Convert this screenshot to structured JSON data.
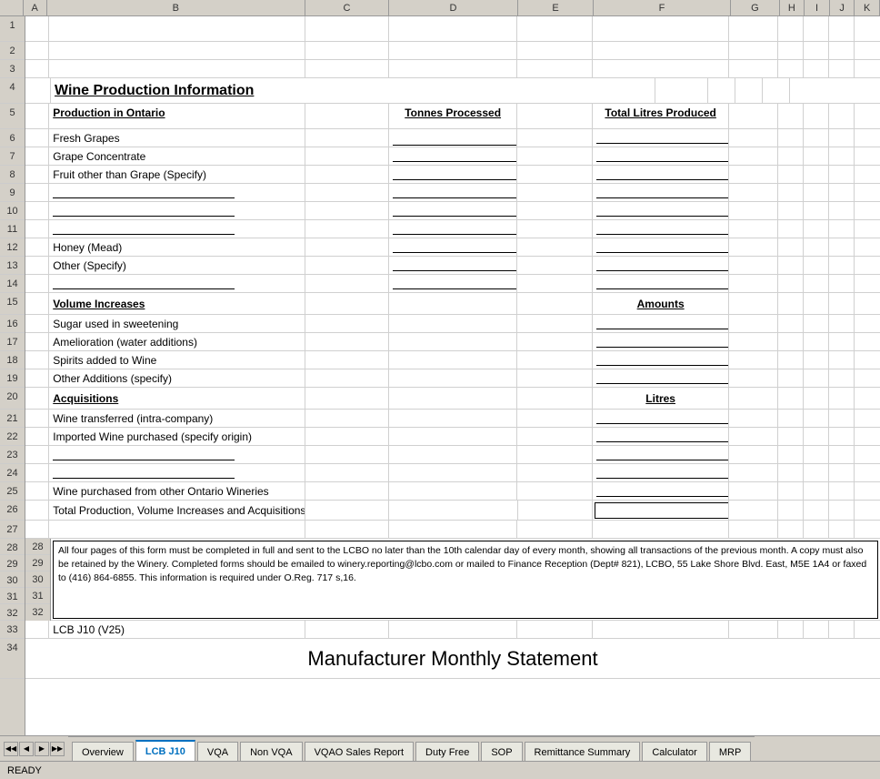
{
  "title": "Wine Production Information",
  "columns": [
    "",
    "A",
    "B",
    "C",
    "D",
    "E",
    "F",
    "G",
    "H",
    "I",
    "J",
    "K"
  ],
  "rows": {
    "row4": {
      "label": "4",
      "content": "Wine Production Information"
    },
    "row5": {
      "label": "5",
      "colB": "Production in Ontario",
      "colD": "Tonnes Processed",
      "colF": "Total Litres Produced"
    },
    "row6": {
      "label": "6",
      "colB": "Fresh Grapes"
    },
    "row7": {
      "label": "7",
      "colB": "Grape Concentrate"
    },
    "row8": {
      "label": "8",
      "colB": "Fruit other than Grape (Specify)"
    },
    "row9": {
      "label": "9"
    },
    "row10": {
      "label": "10"
    },
    "row11": {
      "label": "11"
    },
    "row12": {
      "label": "12",
      "colB": "Honey (Mead)"
    },
    "row13": {
      "label": "13",
      "colB": "Other (Specify)"
    },
    "row14": {
      "label": "14"
    },
    "row15": {
      "label": "15",
      "colB": "Volume Increases",
      "colF": "Amounts"
    },
    "row16": {
      "label": "16",
      "colB": "Sugar used in sweetening"
    },
    "row17": {
      "label": "17",
      "colB": "Amelioration (water additions)"
    },
    "row18": {
      "label": "18",
      "colB": "Spirits added to Wine"
    },
    "row19": {
      "label": "19",
      "colB": "Other Additions (specify)"
    },
    "row20": {
      "label": "20",
      "colB": "Acquisitions",
      "colF": "Litres"
    },
    "row21": {
      "label": "21",
      "colB": "Wine transferred (intra-company)"
    },
    "row22": {
      "label": "22",
      "colB": "Imported Wine purchased (specify origin)"
    },
    "row23": {
      "label": "23"
    },
    "row24": {
      "label": "24"
    },
    "row25": {
      "label": "25",
      "colB": "Wine purchased from other Ontario Wineries"
    },
    "row26": {
      "label": "26",
      "colB": "Total Production, Volume Increases and Acquisitions"
    },
    "row27": {
      "label": "27"
    },
    "row28": {
      "label": "28"
    },
    "row29": {
      "label": "29"
    },
    "row30": {
      "label": "30"
    },
    "row31": {
      "label": "31"
    },
    "row32": {
      "label": "32"
    },
    "row33": {
      "label": "33",
      "content": "LCB J10 (V25)"
    },
    "row34": {
      "label": "34"
    }
  },
  "notice_text": "All four pages of this form must be completed in full and sent to the LCBO no later than the 10th calendar day of every month, showing all transactions of the previous month. A copy must also be retained by the Winery. Completed forms should be emailed to winery.reporting@lcbo.com or mailed to Finance Reception (Dept# 821), LCBO, 55 Lake Shore Blvd. East, M5E 1A4 or faxed to (416) 864-6855. This information is required under O.Reg. 717 s,16.",
  "big_title": "Manufacturer Monthly Statement",
  "version": "LCB J10 (V25)",
  "status": "READY",
  "tabs": [
    {
      "label": "Overview",
      "active": false
    },
    {
      "label": "LCB J10",
      "active": true
    },
    {
      "label": "VQA",
      "active": false
    },
    {
      "label": "Non VQA",
      "active": false
    },
    {
      "label": "VQAO Sales Report",
      "active": false
    },
    {
      "label": "Duty Free",
      "active": false
    },
    {
      "label": "SOP",
      "active": false
    },
    {
      "label": "Remittance Summary",
      "active": false
    },
    {
      "label": "Calculator",
      "active": false
    },
    {
      "label": "MRP",
      "active": false
    }
  ]
}
